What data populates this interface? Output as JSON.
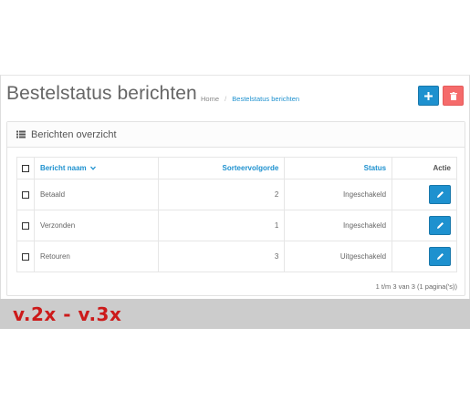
{
  "header": {
    "title": "Bestelstatus berichten",
    "breadcrumb": [
      {
        "label": "Home"
      },
      {
        "label": "Bestelstatus berichten"
      }
    ],
    "breadcrumb_sep": "/",
    "add_icon": "plus-icon",
    "delete_icon": "trash-icon"
  },
  "panel": {
    "title": "Berichten overzicht",
    "icon": "list-icon"
  },
  "table": {
    "columns": {
      "name": "Bericht naam",
      "sort": "Sorteervolgorde",
      "status": "Status",
      "actie": "Actie"
    },
    "rows": [
      {
        "name": "Betaald",
        "sort": "2",
        "status": "Ingeschakeld"
      },
      {
        "name": "Verzonden",
        "sort": "1",
        "status": "Ingeschakeld"
      },
      {
        "name": "Retouren",
        "sort": "3",
        "status": "Uitgeschakeld"
      }
    ]
  },
  "pagination": {
    "text": "1 t/m 3 van 3 (1 pagina('s))"
  },
  "version": {
    "label": "v.2x - v.3x"
  },
  "colors": {
    "primary": "#1e91cf",
    "danger": "#f56b6b",
    "version_text": "#cc1a1a",
    "version_bg": "#cccccc"
  }
}
